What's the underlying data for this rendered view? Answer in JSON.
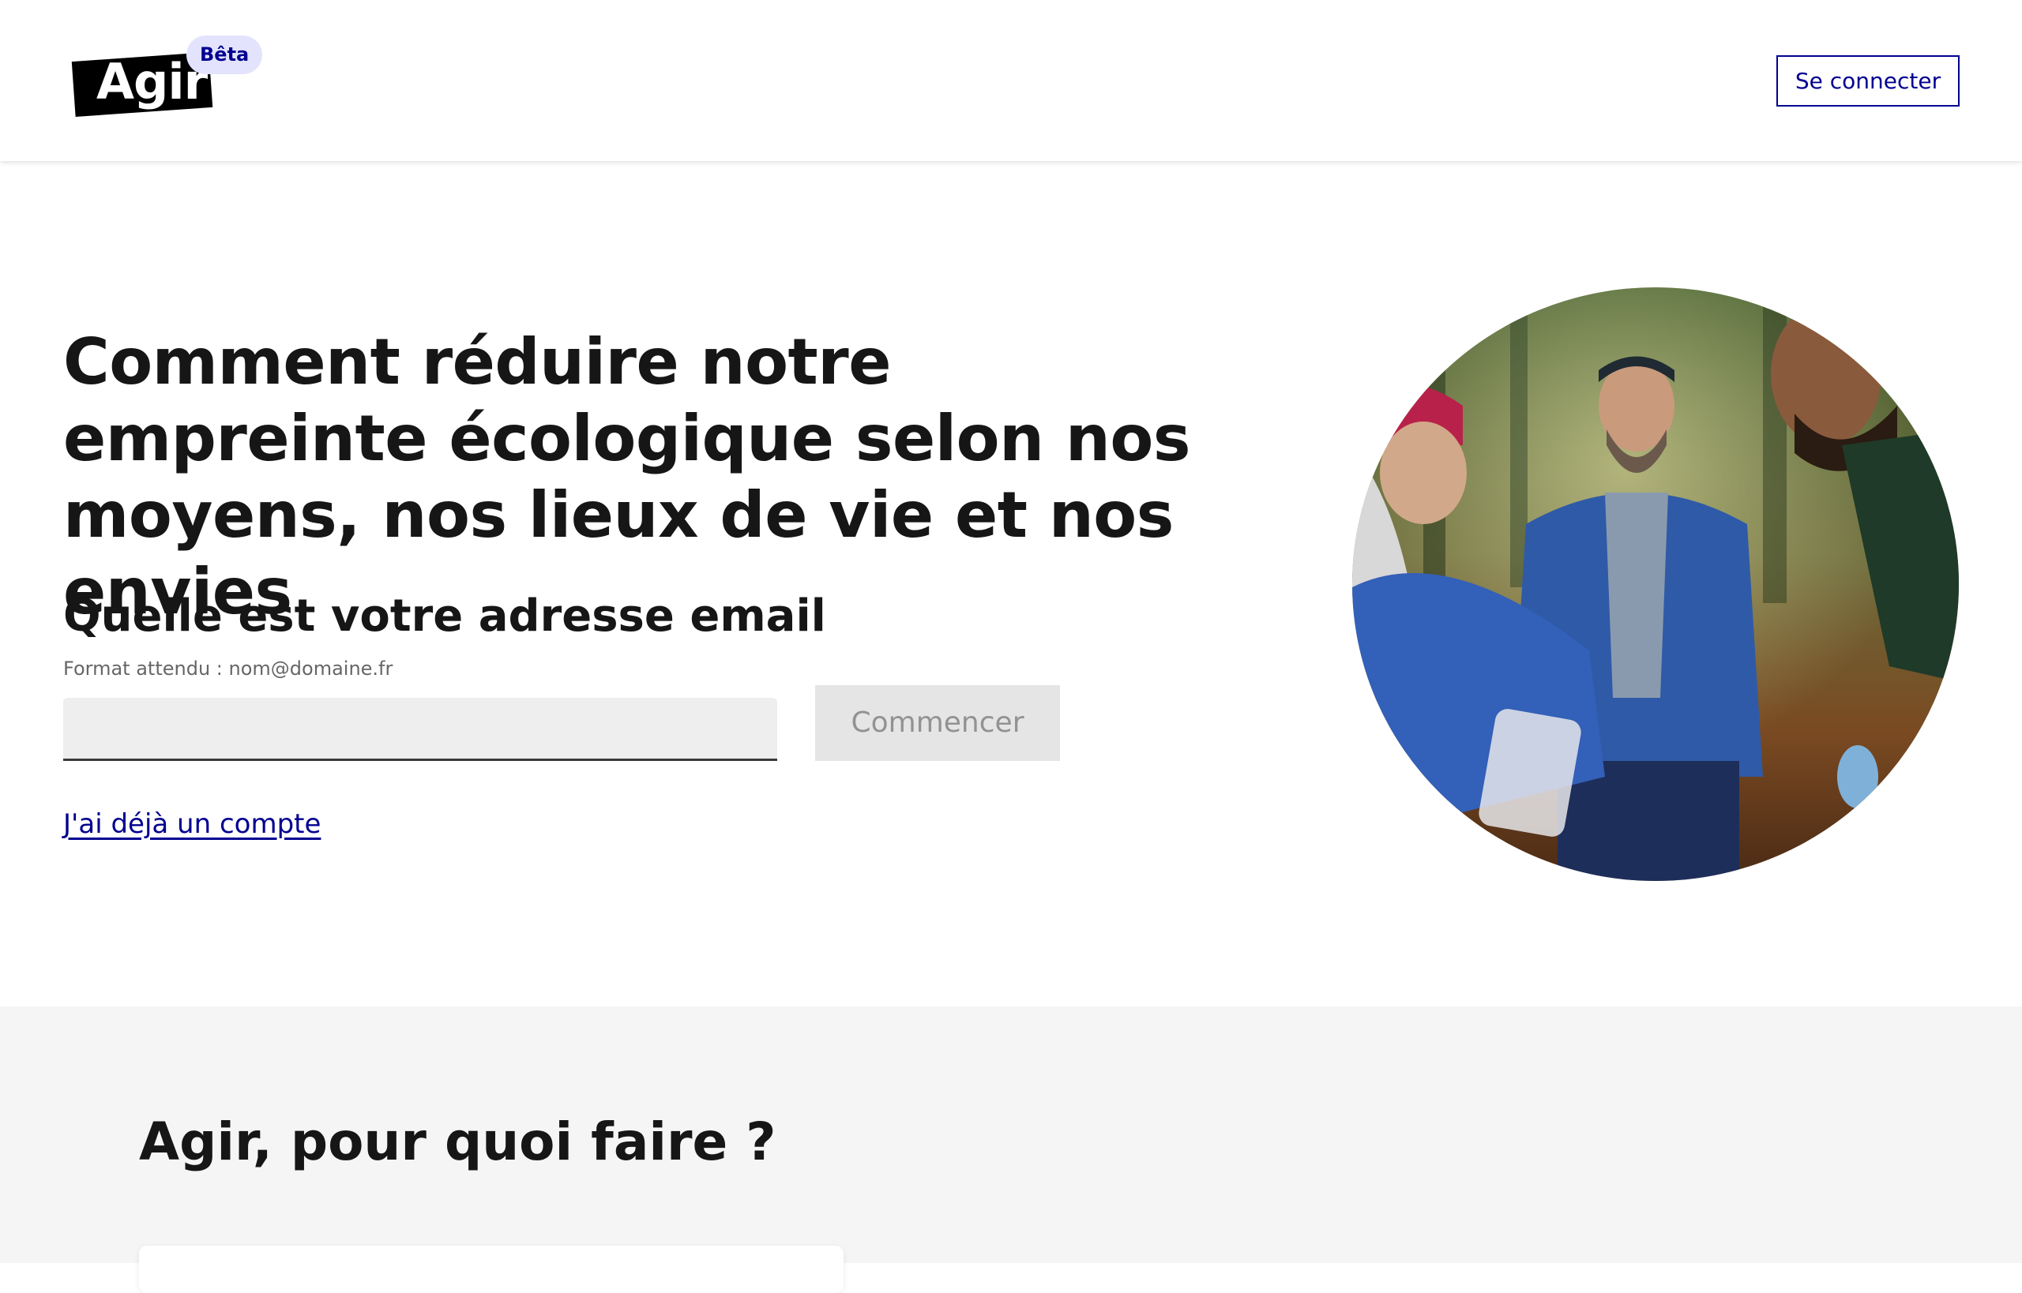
{
  "header": {
    "logo_text": "Agir",
    "beta_label": "Bêta",
    "connect_label": "Se connecter"
  },
  "hero": {
    "title": "Comment réduire notre empreinte écologique selon nos moyens, nos lieux de vie et nos envies",
    "email_label": "Quelle est votre adresse email",
    "email_hint": "Format attendu : nom@domaine.fr",
    "email_value": "",
    "start_label": "Commencer",
    "account_link": "J'ai déjà un compte"
  },
  "section2": {
    "title": "Agir, pour quoi faire ?"
  },
  "colors": {
    "primary": "#000091",
    "beta_bg": "#e3e3fd",
    "section_bg": "#f5f5f5",
    "input_bg": "#eeeeee",
    "disabled_btn_bg": "#e5e5e5"
  }
}
